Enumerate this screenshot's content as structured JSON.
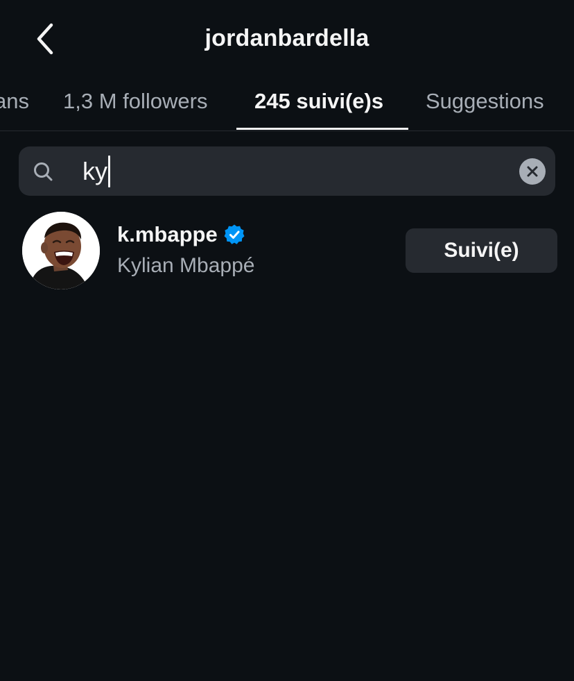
{
  "header": {
    "title": "jordanbardella",
    "back_icon": "chevron-left-icon"
  },
  "tabs": [
    {
      "label": "ans",
      "active": false
    },
    {
      "label": "1,3 M followers",
      "active": false
    },
    {
      "label": "245 suivi(e)s",
      "active": true
    },
    {
      "label": "Suggestions",
      "active": false
    }
  ],
  "search": {
    "value": "ky",
    "search_icon": "search-icon",
    "clear_icon": "clear-icon"
  },
  "results": [
    {
      "username": "k.mbappe",
      "verified": true,
      "full_name": "Kylian Mbappé",
      "button_label": "Suivi(e)"
    }
  ],
  "colors": {
    "background": "#0c1014",
    "surface": "#262a30",
    "text_primary": "#f5f5f5",
    "text_secondary": "#a8aeb6",
    "verified_blue": "#0095f6"
  }
}
